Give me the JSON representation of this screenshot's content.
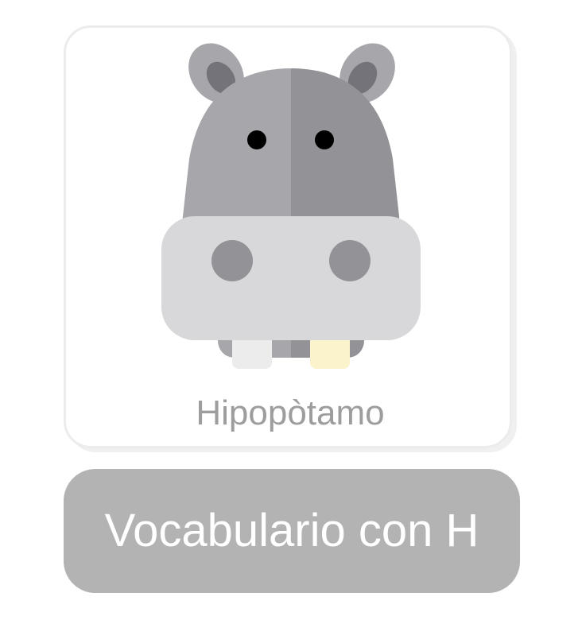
{
  "card": {
    "image_icon": "hippo-icon",
    "word": "Hipopòtamo"
  },
  "banner": {
    "title": "Vocabulario con H"
  },
  "colors": {
    "head_left": "#a7a6ab",
    "head_right": "#939297",
    "ear_inner": "#74737a",
    "snout": "#d8d8db",
    "nostril": "#939297",
    "eye": "#000000",
    "tooth_left": "#ececec",
    "tooth_right": "#fbf3cc",
    "word_text": "#9d9d9d",
    "banner_bg": "#b3b3b3",
    "banner_text": "#ffffff"
  }
}
